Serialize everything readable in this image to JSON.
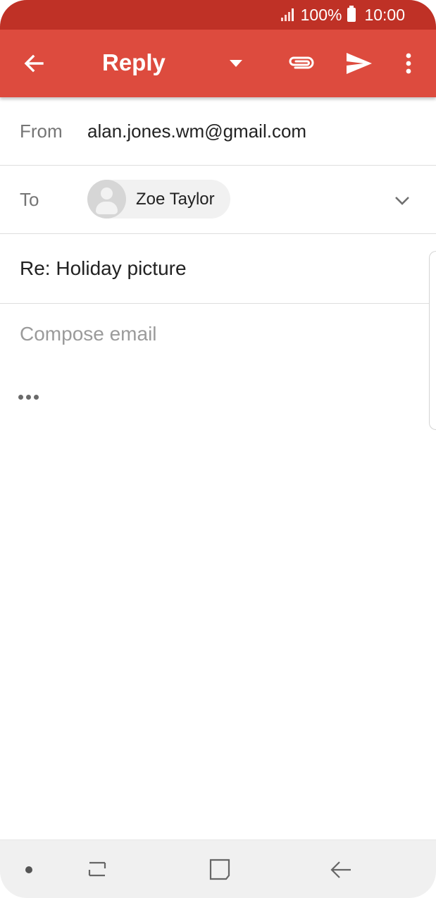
{
  "status_bar": {
    "battery": "100%",
    "time": "10:00"
  },
  "app_bar": {
    "title": "Reply",
    "icons": [
      "back-arrow-icon",
      "dropdown-triangle-icon",
      "paperclip-icon",
      "send-icon",
      "more-vert-icon"
    ]
  },
  "from": {
    "label": "From",
    "value": "alan.jones.wm@gmail.com"
  },
  "to": {
    "label": "To",
    "recipient": "Zoe Taylor"
  },
  "subject": "Re: Holiday picture",
  "body": {
    "placeholder": "Compose email"
  },
  "colors": {
    "status_bar": "#bf3126",
    "app_bar": "#dd4b3e",
    "nav_bar": "#f0f0f0"
  }
}
